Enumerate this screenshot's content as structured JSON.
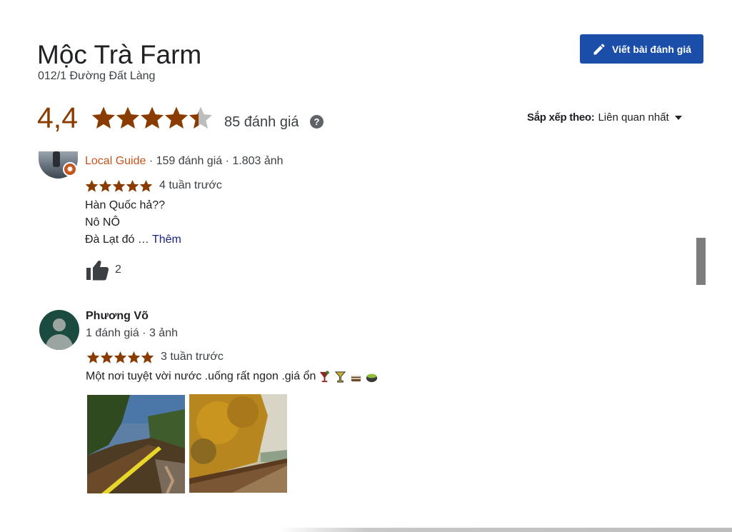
{
  "place": {
    "title": "Mộc Trà Farm",
    "address": "012/1 Đường Đất Làng"
  },
  "toolbar": {
    "write_review_label": "Viết bài đánh giá",
    "write_review_icon": "pencil-icon"
  },
  "rating": {
    "value": "4,4",
    "stars_value": 4.4,
    "count_label": "85 đánh giá",
    "help_icon": "question-circle-icon",
    "help_glyph": "?"
  },
  "sort": {
    "label": "Sắp xếp theo:",
    "value": "Liên quan nhất"
  },
  "reviews": [
    {
      "badge": "Local Guide",
      "stats": " · 159 đánh giá · 1.803 ảnh",
      "stars": 5,
      "time": "4 tuần trước",
      "lines": [
        "Hàn Quốc hả??",
        "Nô NÔ",
        "Đà Lạt đó … "
      ],
      "more_label": "Thêm",
      "likes": "2"
    },
    {
      "name": "Phương Võ",
      "stats": "1 đánh giá · 3 ảnh",
      "stars": 5,
      "time": "3 tuần trước",
      "text": "Một nơi tuyệt vời nước .uống rất ngon .giá ổn",
      "emoji": [
        "cocktail-icon",
        "martini-icon",
        "cake-icon",
        "matcha-icon"
      ]
    }
  ],
  "colors": {
    "accent": "#1a4ea8",
    "star": "#8a3b00",
    "local_guide": "#c5531b",
    "more_link": "#1a237e"
  }
}
